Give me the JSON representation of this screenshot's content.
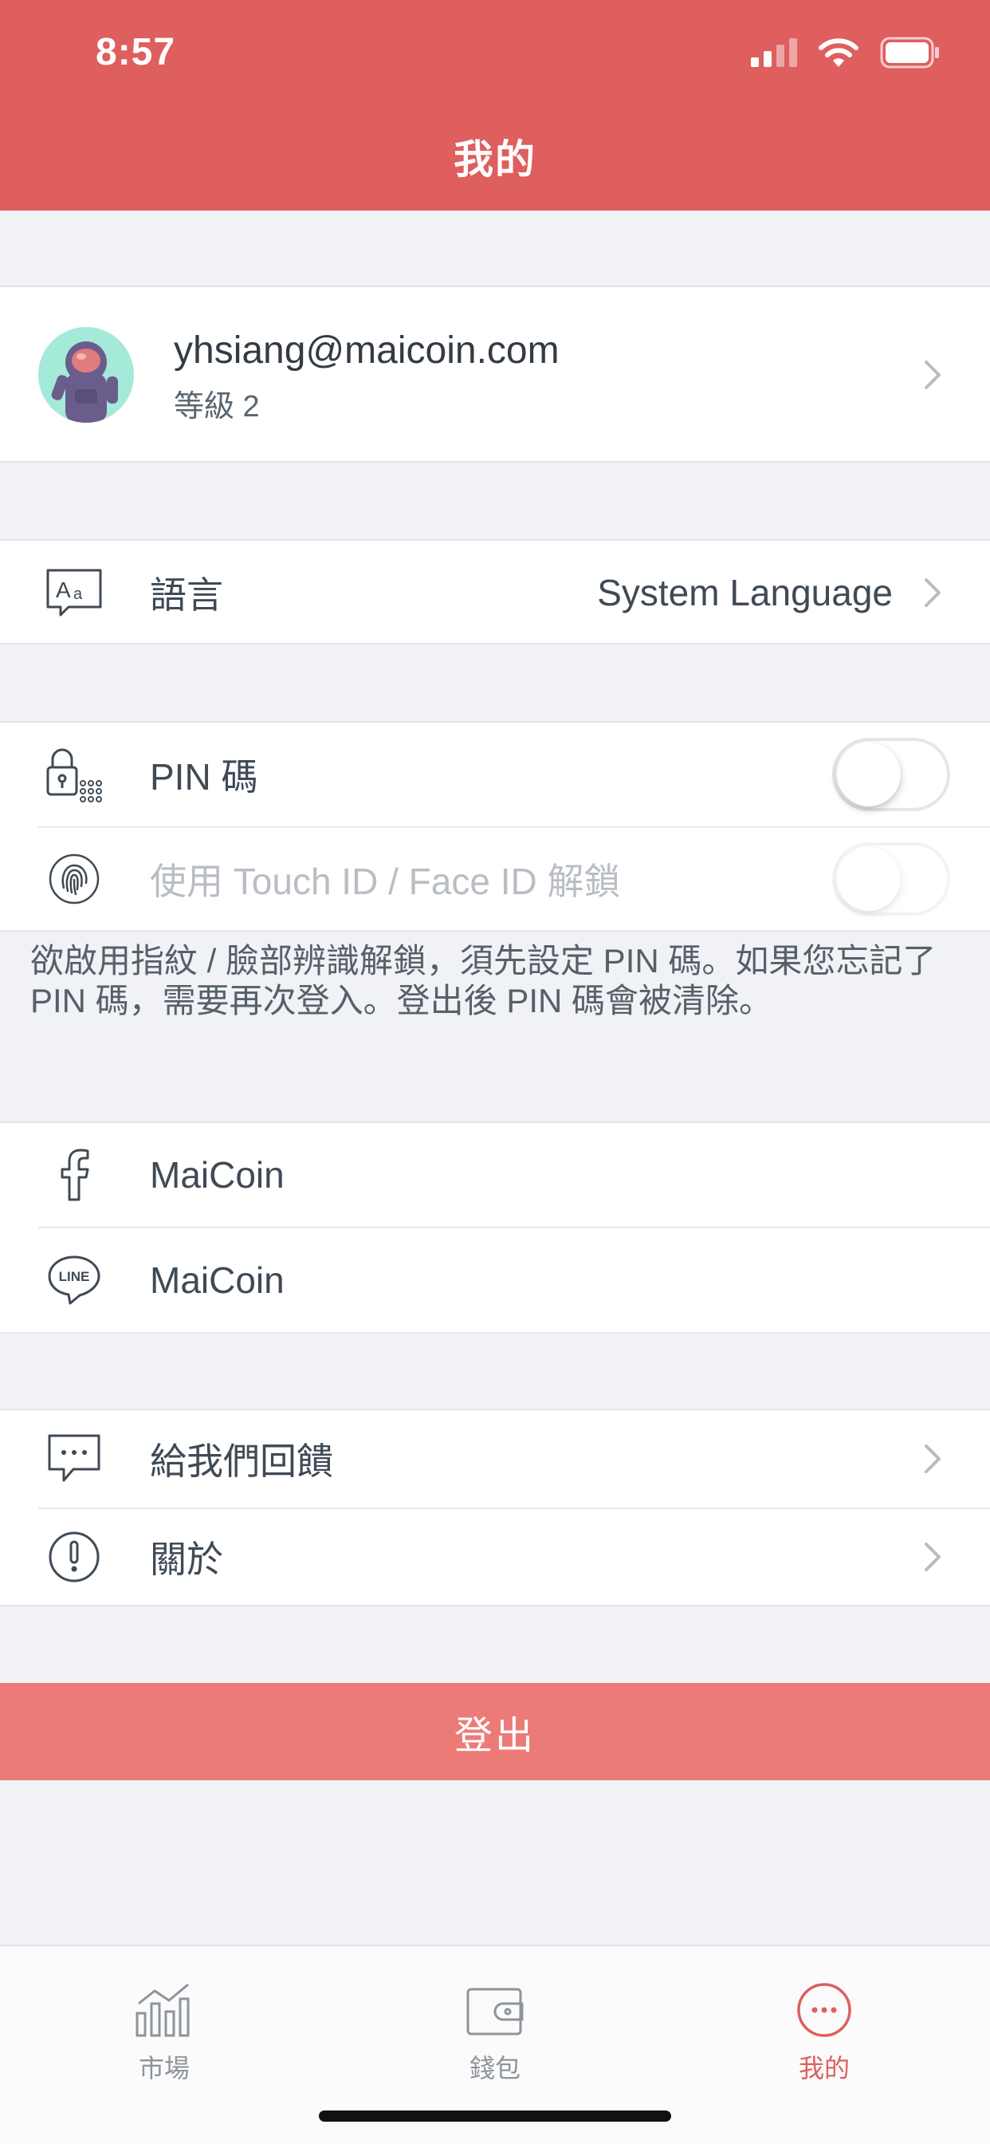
{
  "status_bar": {
    "time": "8:57"
  },
  "header": {
    "title": "我的"
  },
  "profile": {
    "email": "yhsiang@maicoin.com",
    "level": "等級 2"
  },
  "language": {
    "label": "語言",
    "value": "System Language"
  },
  "security": {
    "pin_label": "PIN 碼",
    "pin_enabled": false,
    "biometric_label": "使用 Touch ID / Face ID 解鎖",
    "biometric_enabled": false,
    "note": "欲啟用指紋 / 臉部辨識解鎖，須先設定 PIN 碼。如果您忘記了 PIN 碼，需要再次登入。登出後 PIN 碼會被清除。"
  },
  "social": {
    "facebook_label": "MaiCoin",
    "line_label": "MaiCoin",
    "line_icon_text": "LINE"
  },
  "misc": {
    "feedback_label": "給我們回饋",
    "about_label": "關於"
  },
  "logout_label": "登出",
  "tabs": [
    {
      "label": "市場",
      "icon": "chart-icon",
      "active": false
    },
    {
      "label": "錢包",
      "icon": "wallet-icon",
      "active": false
    },
    {
      "label": "我的",
      "icon": "more-icon",
      "active": true
    }
  ],
  "colors": {
    "brand": "#df5e5e",
    "logout": "#ec7b78",
    "background": "#f1f2f5"
  }
}
